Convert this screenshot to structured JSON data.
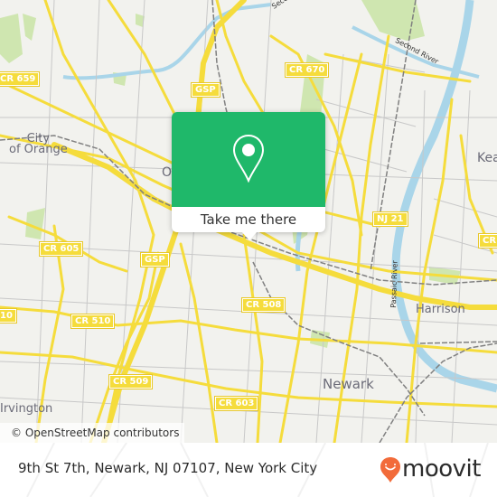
{
  "map": {
    "road_shields": [
      {
        "id": "cr-659",
        "label": "CR 659"
      },
      {
        "id": "gsp-north",
        "label": "GSP"
      },
      {
        "id": "cr-670",
        "label": "CR 670"
      },
      {
        "id": "nj-21",
        "label": "NJ 21"
      },
      {
        "id": "cr-east",
        "label": "CR"
      },
      {
        "id": "cr-605",
        "label": "CR 605"
      },
      {
        "id": "gsp-south",
        "label": "GSP"
      },
      {
        "id": "cr-510-west",
        "label": "10"
      },
      {
        "id": "cr-510",
        "label": "CR 510"
      },
      {
        "id": "cr-508",
        "label": "CR 508"
      },
      {
        "id": "cr-509",
        "label": "CR 509"
      },
      {
        "id": "cr-603",
        "label": "CR 603"
      }
    ],
    "places": [
      {
        "id": "city-of-orange",
        "label": "City\nof Orange"
      },
      {
        "id": "orange-partial",
        "label": "O"
      },
      {
        "id": "kearny-partial",
        "label": "Kea"
      },
      {
        "id": "harrison",
        "label": "Harrison"
      },
      {
        "id": "newark",
        "label": "Newark"
      },
      {
        "id": "irvington",
        "label": "Irvington"
      }
    ],
    "water_labels": [
      {
        "id": "second-river",
        "label": "Second River"
      },
      {
        "id": "second-river-top",
        "label": "Seco"
      },
      {
        "id": "passaic-river",
        "label": "Passaic River"
      }
    ],
    "attribution": "© OpenStreetMap contributors",
    "colors": {
      "background": "#f2f2ee",
      "major_road": "#f5dc3c",
      "minor_road": "#c8c8c8",
      "water": "#a9d5e9",
      "park": "#cfe6b0",
      "rail": "#808080"
    }
  },
  "popup": {
    "icon": "map-pin-icon",
    "button_label": "Take me there",
    "color": "#1fb86a"
  },
  "footer": {
    "address": "9th St 7th, Newark, NJ 07107, New York City",
    "brand": "moovit",
    "brand_color": "#f26b3a"
  }
}
